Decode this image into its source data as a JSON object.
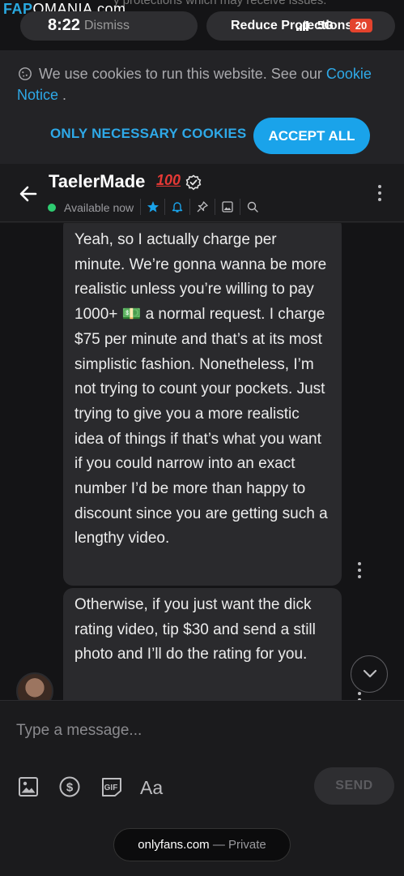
{
  "status_bar": {
    "watermark_brand": "FAP",
    "watermark_rest": "OMANIA.com",
    "background_text": "y protections which may receive issues.",
    "time": "8:22",
    "dismiss_label": "Dismiss",
    "reduce_label": "Reduce Protections",
    "network": "5G",
    "battery": "20",
    "battery_color": "#e3432d"
  },
  "cookie_banner": {
    "text": "We use cookies to run this website. See our",
    "link": "Cookie Notice",
    "trailing": ".",
    "necessary_label": "ONLY NECESSARY COOKIES",
    "accept_label": "ACCEPT ALL",
    "accent": "#1aa3ea"
  },
  "chat_header": {
    "name": "TaelerMade",
    "emoji": "100",
    "status": "Available now",
    "status_color": "#2ecc71",
    "icons": [
      "star-icon",
      "bell-icon",
      "pin-icon",
      "gallery-icon",
      "search-icon"
    ]
  },
  "messages": [
    {
      "text": "Yeah, so I actually charge per minute. We’re gonna wanna be more realistic unless you’re willing to pay 1000+ 💵 a normal request. I charge $75 per minute and that’s at its most simplistic fashion. Nonetheless, I’m not trying to count your pockets. Just trying to give you a more realistic idea of things if that’s what you want if you could narrow into an exact number I’d be more than happy to discount since you are getting such a lengthy video."
    },
    {
      "text": "Otherwise, if you just want the dick rating video, tip $30 and send a still photo and I’ll do the rating for you."
    }
  ],
  "composer": {
    "placeholder": "Type a message...",
    "gif_label": "GIF",
    "text_format_label": "Aa",
    "send_label": "SEND"
  },
  "browser": {
    "domain": "onlyfans.com",
    "dash": " — ",
    "mode": "Private"
  }
}
